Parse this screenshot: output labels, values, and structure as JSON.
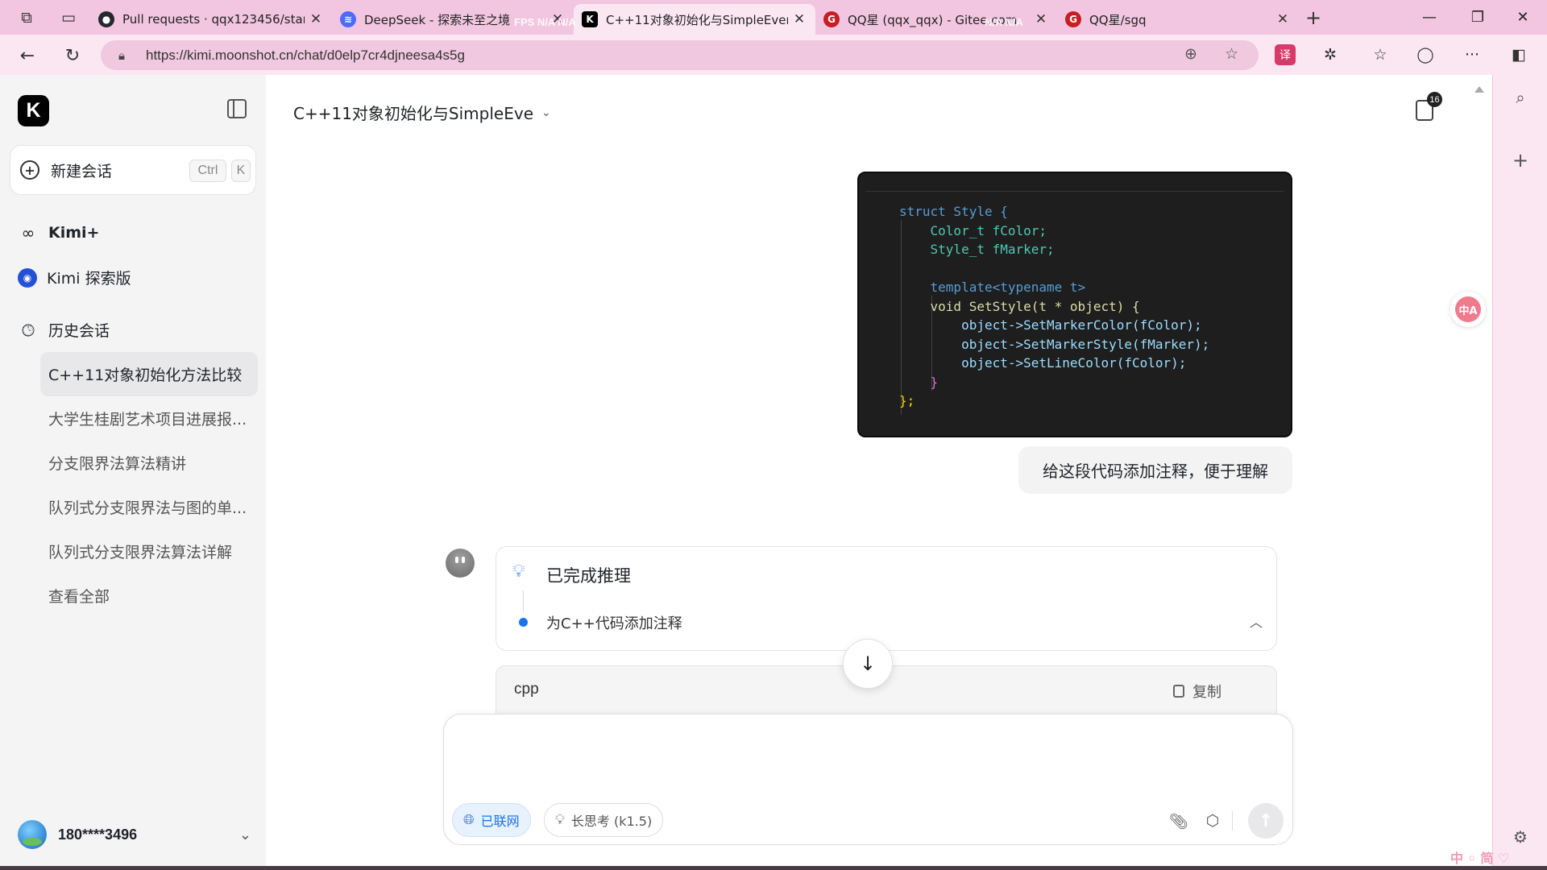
{
  "browser": {
    "tabs": [
      {
        "title": "Pull requests · qqx123456/starterl",
        "favicon": "github-icon",
        "color": "#24292f"
      },
      {
        "title": "DeepSeek - 探索未至之境",
        "favicon": "deepseek-icon",
        "color": "#4d6bfe"
      },
      {
        "title": "C++11对象初始化与SimpleEvent",
        "favicon": "kimi-icon",
        "color": "#000000"
      },
      {
        "title": "QQ星 (qqx_qqx) - Gitee.com",
        "favicon": "gitee-icon",
        "color": "#c71d23"
      },
      {
        "title": "QQ星/sgq",
        "favicon": "gitee-icon",
        "color": "#c71d23"
      }
    ],
    "fps_overlay": [
      "FPS N/A N/A",
      "N/A N/A"
    ],
    "url": "https://kimi.moonshot.cn/chat/d0elp7cr4djneesa4s5g"
  },
  "sidebar": {
    "logo": "K",
    "new_chat": {
      "label": "新建会话",
      "shortcut_ctrl": "Ctrl",
      "shortcut_key": "K"
    },
    "kimi_plus": "Kimi+",
    "kimi_explore": "Kimi 探索版",
    "history_label": "历史会话",
    "history": [
      "C++11对象初始化方法比较",
      "大学生桂剧艺术项目进展报...",
      "分支限界法算法精讲",
      "队列式分支限界法与图的单...",
      "队列式分支限界法算法详解"
    ],
    "view_all": "查看全部",
    "user": {
      "name": "180****3496"
    }
  },
  "main": {
    "chat_title": "C++11对象初始化与SimpleEve",
    "doc_badge": "16",
    "code_image_lines": [
      "struct Style {",
      "Color_t fColor;",
      "Style_t fMarker;",
      "",
      "template<typename t>",
      "void SetStyle(t * object) {",
      "object->SetMarkerColor(fColor);",
      "object->SetMarkerStyle(fMarker);",
      "object->SetLineColor(fColor);",
      "}",
      "};"
    ],
    "user_message": "给这段代码添加注释，便于理解",
    "reasoning": {
      "status": "已完成推理",
      "step": "为C++代码添加注释"
    },
    "code_block": {
      "lang": "cpp",
      "copy_label": "复制"
    },
    "input": {
      "placeholder": "",
      "web_chip": "已联网",
      "think_chip": "长思考 (k1.5)"
    }
  },
  "ime_indicator": "中 ◦ 简 ♡"
}
